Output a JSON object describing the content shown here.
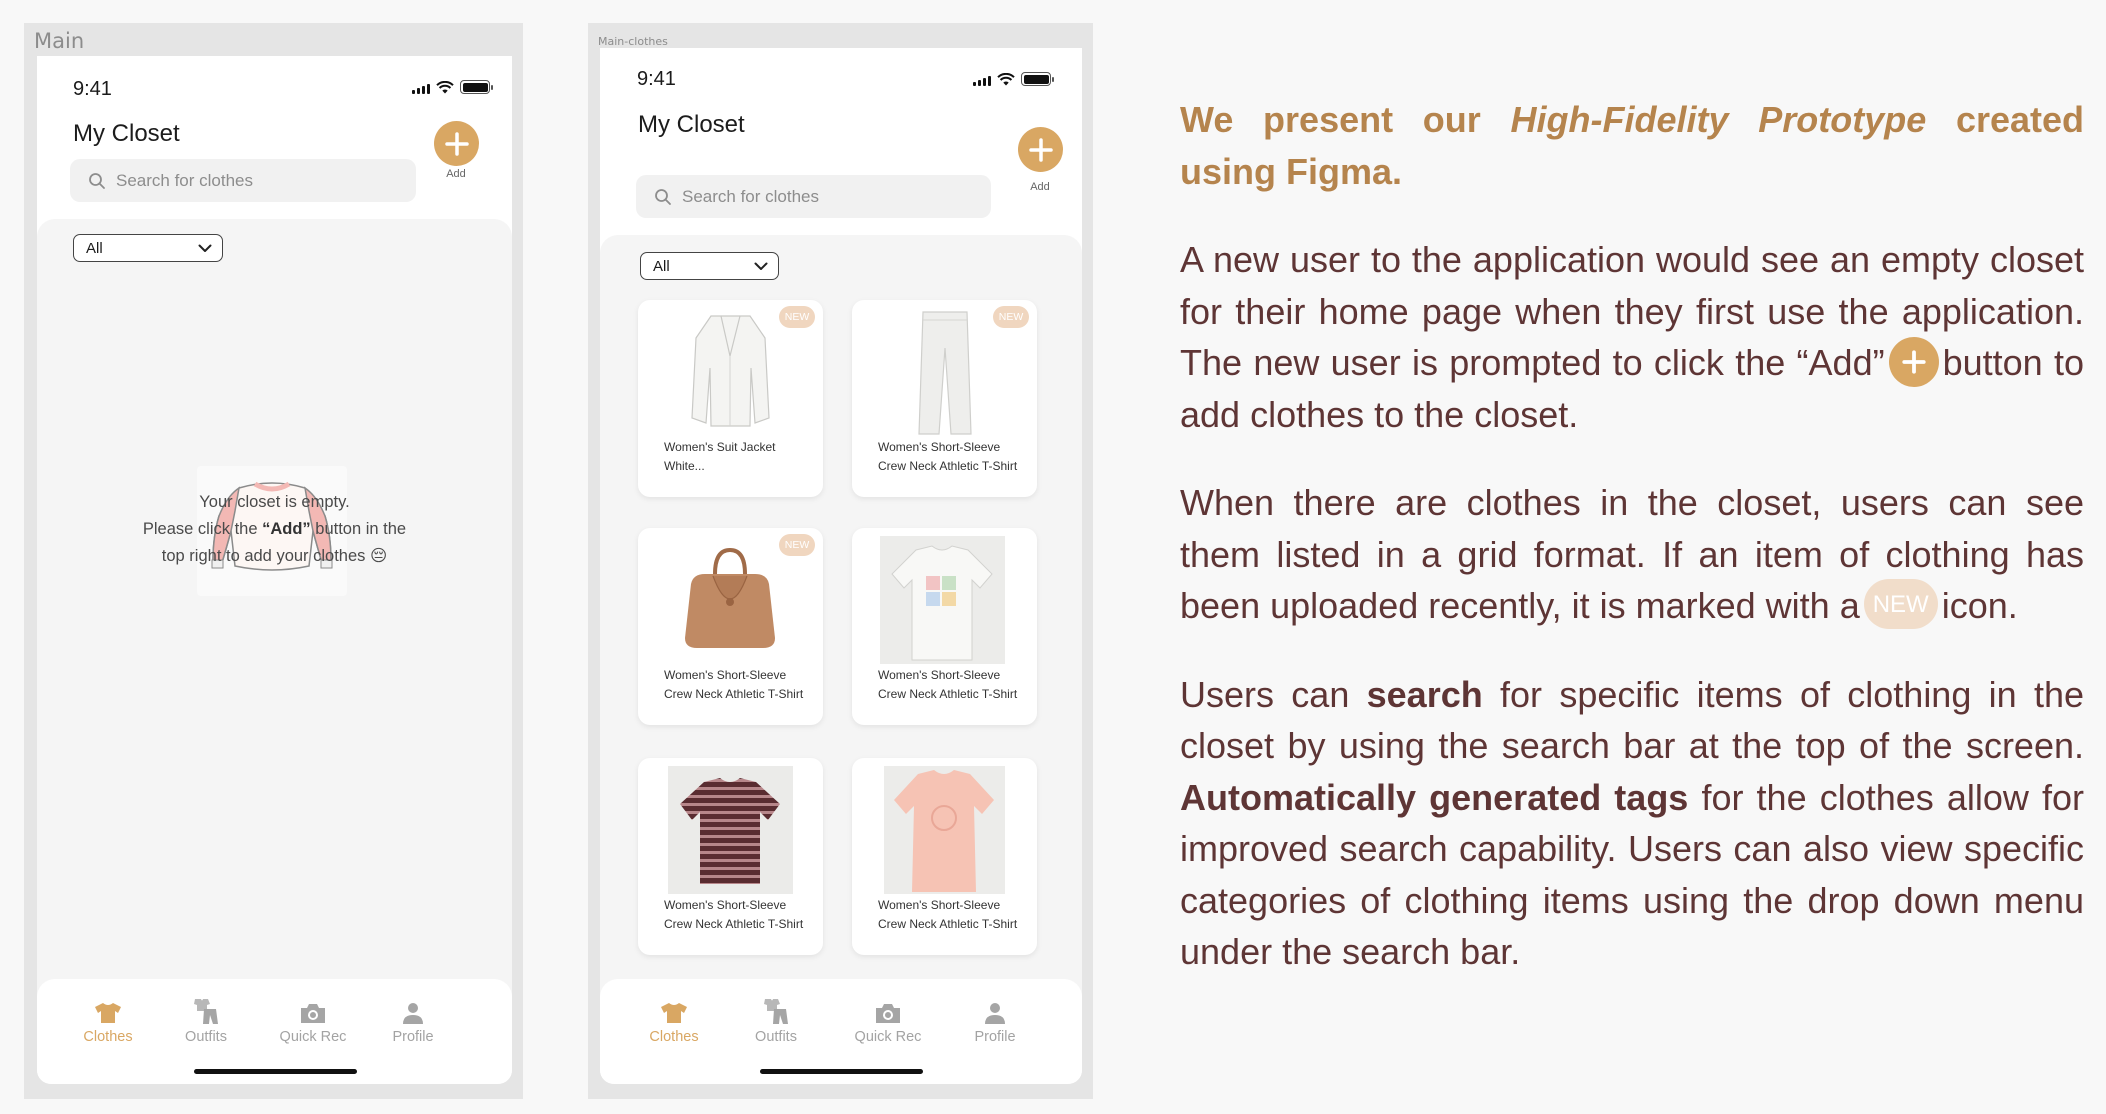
{
  "colors": {
    "accent": "#d9a763",
    "badge": "#f0d6bf",
    "text_brown": "#5e3535",
    "heading_gold": "#b5844d"
  },
  "frames": {
    "main": {
      "label": "Main"
    },
    "clothes": {
      "label": "Main-clothes"
    }
  },
  "status": {
    "time": "9:41"
  },
  "app": {
    "title": "My Closet",
    "add_label": "Add",
    "search_placeholder": "Search for clothes",
    "filter_value": "All"
  },
  "empty_state": {
    "line1": "Your closet is empty.",
    "line2_pre": "Please click the ",
    "line2_bold": "“Add”",
    "line2_post": " button in the",
    "line3": "top right to add your clothes 😔"
  },
  "items": [
    {
      "name": "Women's Suit Jacket White...",
      "is_new": true,
      "image": "white-blazer"
    },
    {
      "name": "Women's Short-Sleeve Crew Neck Athletic T-Shirt",
      "is_new": true,
      "image": "white-trousers"
    },
    {
      "name": "Women's Short-Sleeve Crew Neck Athletic T-Shirt",
      "is_new": true,
      "image": "tan-handbag"
    },
    {
      "name": "Women's Short-Sleeve Crew Neck Athletic T-Shirt",
      "is_new": false,
      "image": "printed-tee"
    },
    {
      "name": "Women's Short-Sleeve Crew Neck Athletic T-Shirt",
      "is_new": false,
      "image": "striped-tee"
    },
    {
      "name": "Women's Short-Sleeve Crew Neck Athletic T-Shirt",
      "is_new": false,
      "image": "pink-tee-dress"
    }
  ],
  "badge_text": "NEW",
  "tabs": [
    {
      "label": "Clothes",
      "icon": "shirt-icon",
      "active": true
    },
    {
      "label": "Outfits",
      "icon": "outfit-icon",
      "active": false
    },
    {
      "label": "Quick Rec",
      "icon": "camera-icon",
      "active": false
    },
    {
      "label": "Profile",
      "icon": "person-icon",
      "active": false
    }
  ],
  "description": {
    "intro_pre": "We present our ",
    "intro_em": "High-Fidelity Prototype",
    "intro_post": " created using Figma.",
    "p2_pre": "A new user to the application would see an empty closet for their home page when they first use the application. The new user is prompted to click the “Add”",
    "p2_post": "button to add clothes to the closet.",
    "p3_pre": "When there are clothes in the closet, users can see them listed in a grid format. If an item of clothing has been uploaded recently, it is marked with a",
    "p3_badge": "NEW",
    "p3_post": "icon.",
    "p4_a": "Users can ",
    "p4_b": "search",
    "p4_c": " for specific items of clothing in the closet by using the search bar at the top of the screen. ",
    "p4_d": "Automatically generated tags",
    "p4_e": " for the clothes allow for improved search capability. Users can also view specific categories of clothing items using the drop down menu under the search bar."
  }
}
